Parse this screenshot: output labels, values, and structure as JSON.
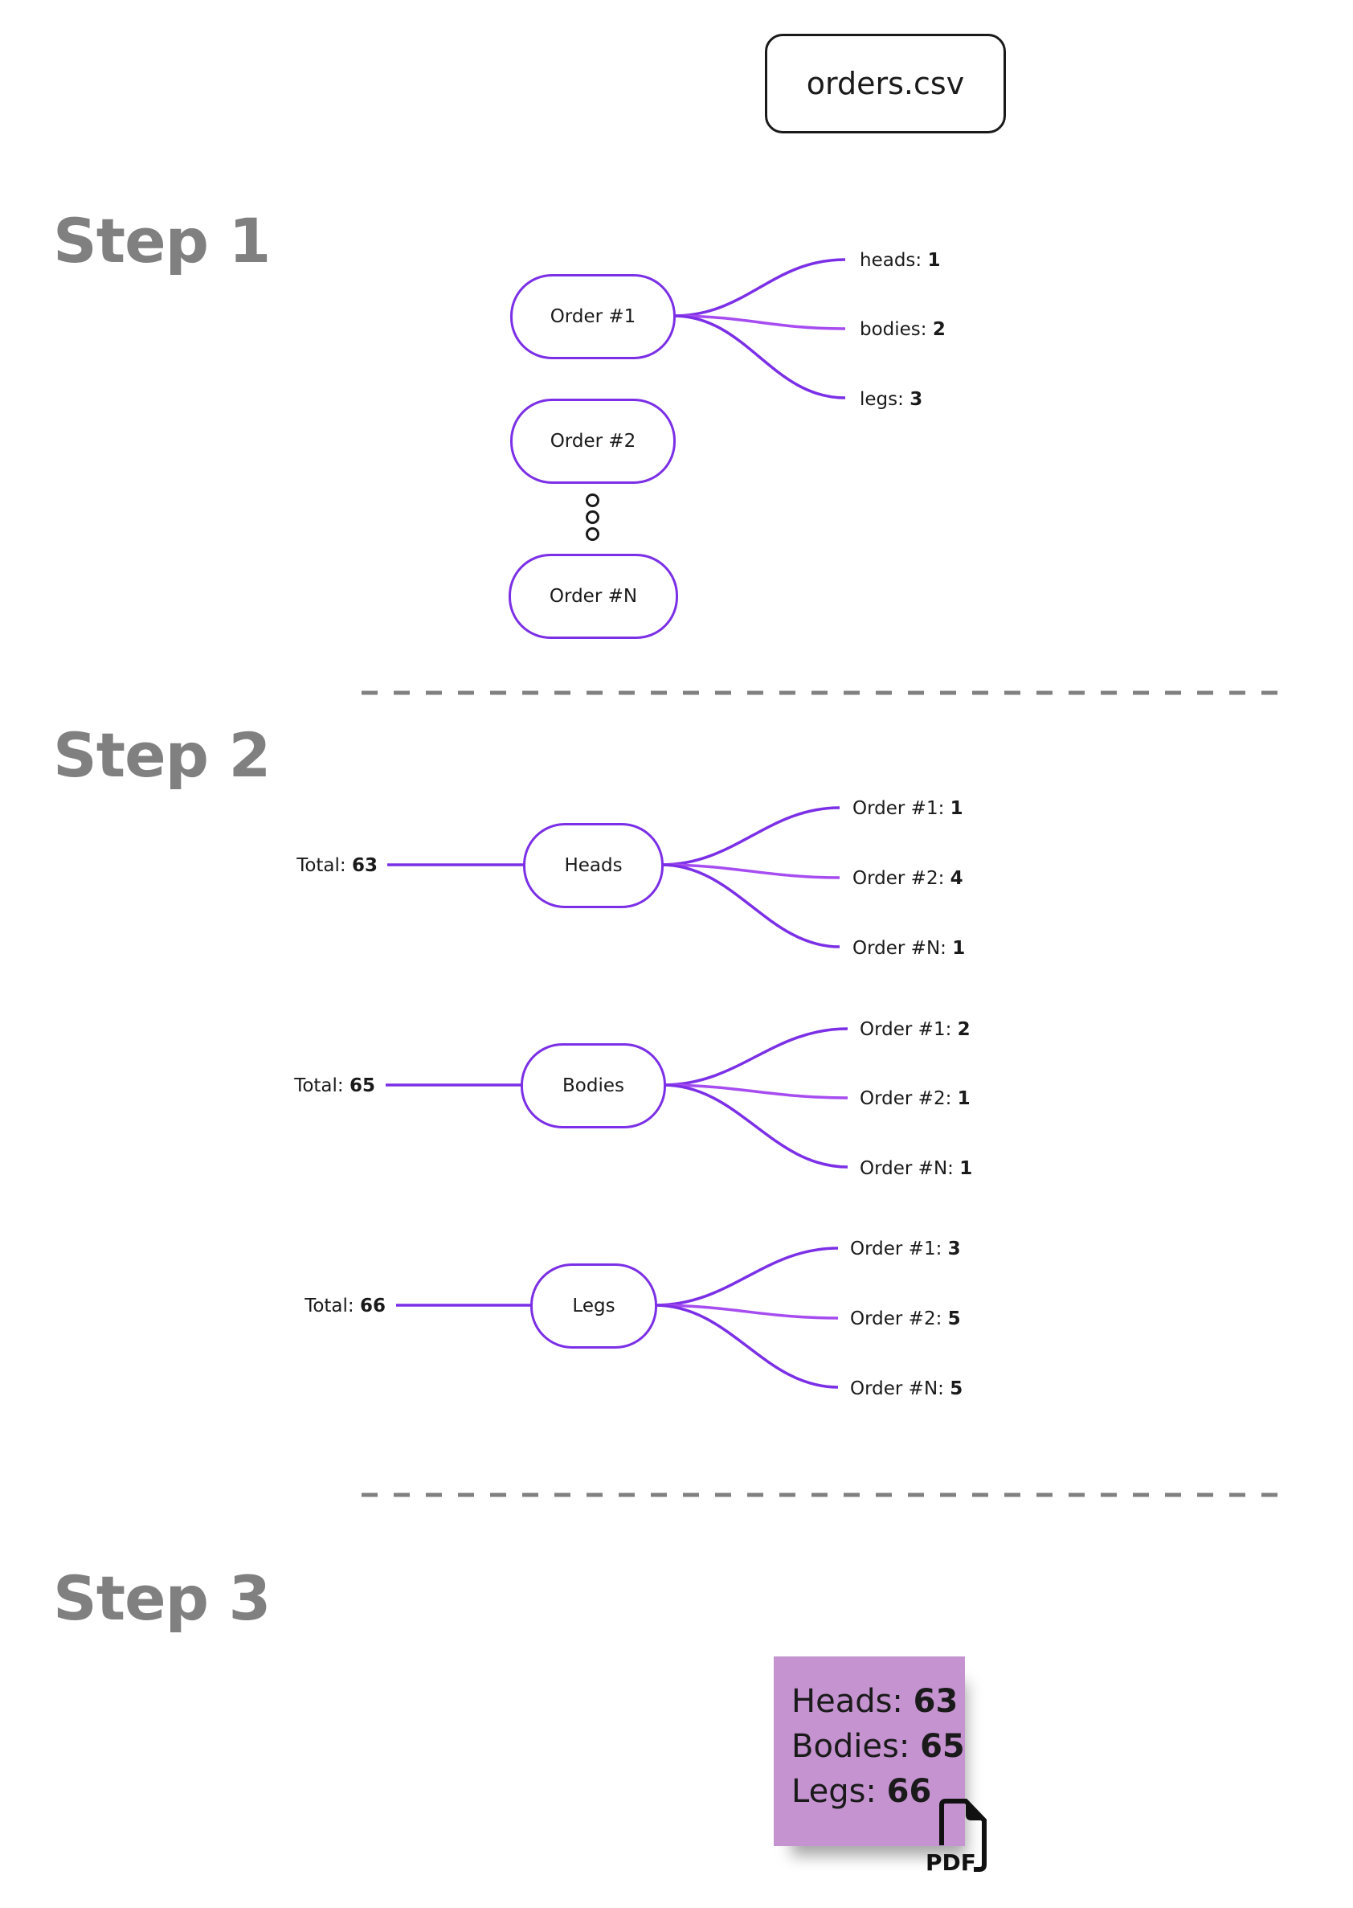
{
  "source_file": {
    "label": "orders.csv"
  },
  "colors": {
    "accent": "#7b2fe6",
    "accent_mid": "#a64cf0",
    "step_title": "#808080",
    "sticky_bg": "#c493d0",
    "divider": "#808080"
  },
  "step1": {
    "title": "Step 1",
    "orders": [
      {
        "label": "Order #1",
        "items": [
          {
            "name": "heads: ",
            "value": "1"
          },
          {
            "name": "bodies: ",
            "value": "2"
          },
          {
            "name": "legs: ",
            "value": "3"
          }
        ]
      },
      {
        "label": "Order #2"
      },
      {
        "label": "Order #N"
      }
    ],
    "ellipsis_icon": "vertical-ellipsis-circles"
  },
  "step2": {
    "title": "Step 2",
    "groups": [
      {
        "label": "Heads",
        "total_label": "Total: ",
        "total": "63",
        "items": [
          {
            "name": "Order #1: ",
            "value": "1"
          },
          {
            "name": "Order #2: ",
            "value": "4"
          },
          {
            "name": "Order #N: ",
            "value": "1"
          }
        ]
      },
      {
        "label": "Bodies",
        "total_label": "Total: ",
        "total": "65",
        "items": [
          {
            "name": "Order #1: ",
            "value": "2"
          },
          {
            "name": "Order #2: ",
            "value": "1"
          },
          {
            "name": "Order #N: ",
            "value": "1"
          }
        ]
      },
      {
        "label": "Legs",
        "total_label": "Total: ",
        "total": "66",
        "items": [
          {
            "name": "Order #1: ",
            "value": "3"
          },
          {
            "name": "Order #2: ",
            "value": "5"
          },
          {
            "name": "Order #N: ",
            "value": "5"
          }
        ]
      }
    ]
  },
  "step3": {
    "title": "Step 3",
    "summary": [
      {
        "name": "Heads: ",
        "value": "63"
      },
      {
        "name": "Bodies: ",
        "value": "65"
      },
      {
        "name": "Legs: ",
        "value": "66"
      }
    ],
    "pdf_icon": {
      "label": "PDF"
    }
  }
}
